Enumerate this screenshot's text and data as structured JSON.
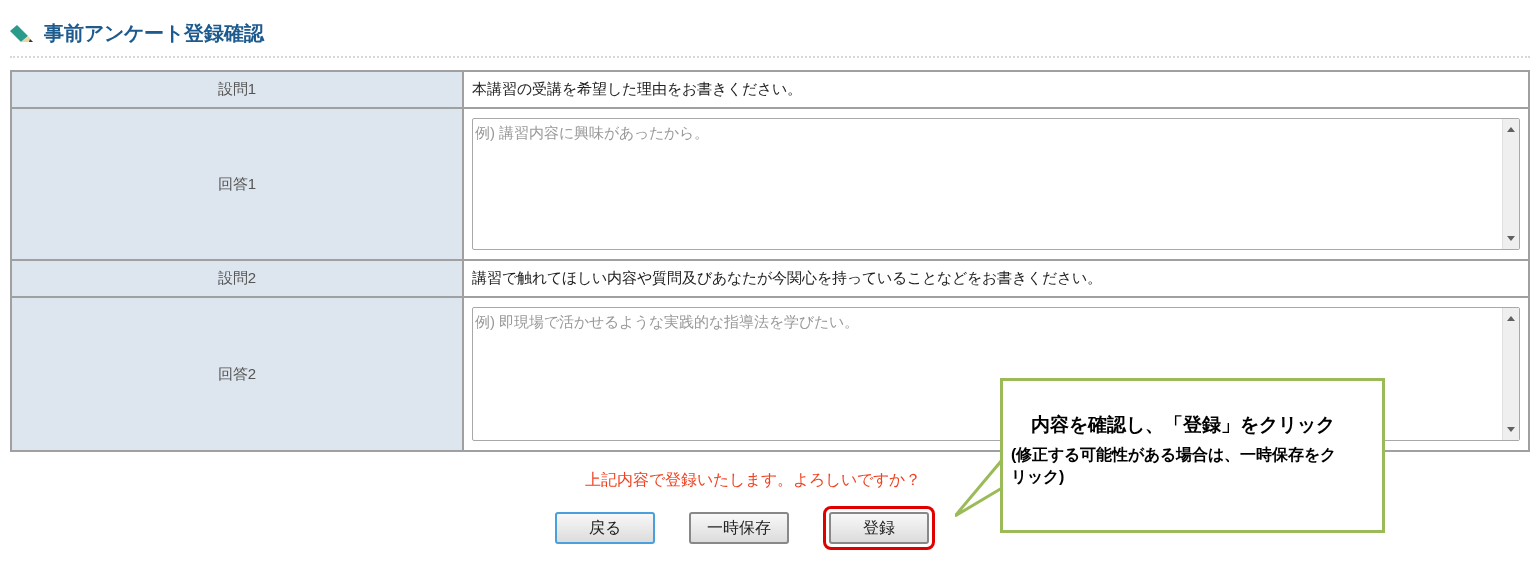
{
  "title": "事前アンケート登録確認",
  "rows": [
    {
      "kind": "question",
      "label": "設問1",
      "text": "本講習の受講を希望した理由をお書きください。"
    },
    {
      "kind": "answer",
      "label": "回答1",
      "placeholder": "例) 講習内容に興味があったから。"
    },
    {
      "kind": "question",
      "label": "設問2",
      "text": "講習で触れてほしい内容や質問及びあなたが今関心を持っていることなどをお書きください。"
    },
    {
      "kind": "answer",
      "label": "回答2",
      "placeholder": "例) 即現場で活かせるような実践的な指導法を学びたい。"
    }
  ],
  "confirm_message": "上記内容で登録いたします。よろしいですか？",
  "buttons": [
    {
      "label": "戻る",
      "focused": true,
      "highlighted": false
    },
    {
      "label": "一時保存",
      "focused": false,
      "highlighted": false
    },
    {
      "label": "登録",
      "focused": false,
      "highlighted": true
    }
  ],
  "callout": {
    "heading": "内容を確認し、「登録」をクリック",
    "note": "(修正する可能性がある場合は、一時保存をクリック)"
  }
}
